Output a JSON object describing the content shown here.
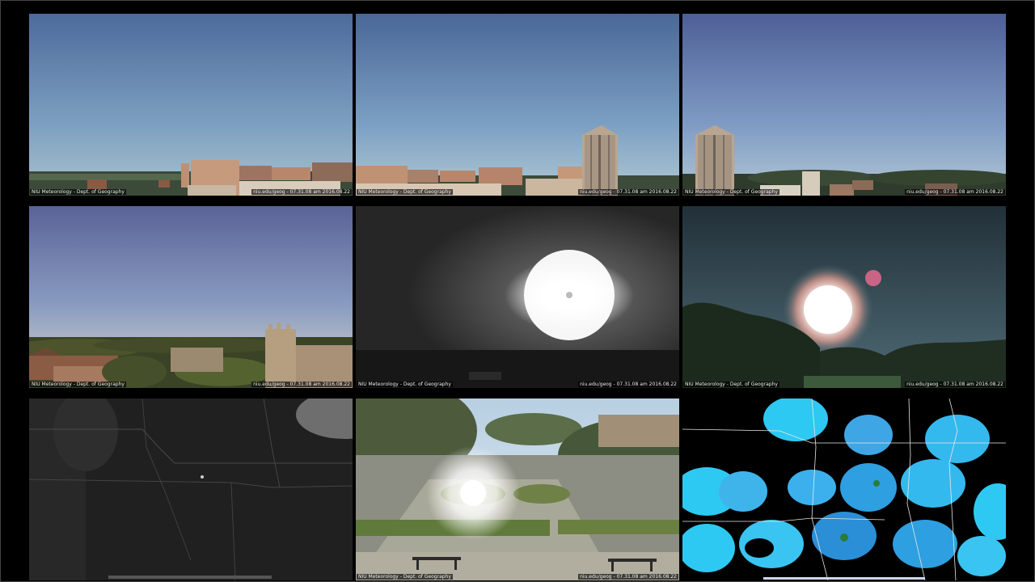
{
  "page": {
    "background_color": "#000000",
    "cameras": [
      {
        "name": "rooftop-east",
        "caption_left": "NIU Meteorology - Dept. of Geography",
        "caption_right": "niu.edu/geog - 07.31.08 am 2016.08.22"
      },
      {
        "name": "rooftop-holmes",
        "caption_left": "NIU Meteorology - Dept. of Geography",
        "caption_right": "niu.edu/geog - 07.31.08 am 2016.08.22"
      },
      {
        "name": "rooftop-northwest",
        "caption_left": "NIU Meteorology - Dept. of Geography",
        "caption_right": "niu.edu/geog - 07.31.08 am 2016.08.22"
      },
      {
        "name": "altgeld-view",
        "caption_left": "NIU Meteorology - Dept. of Geography",
        "caption_right": "niu.edu/geog - 07.31.08 am 2016.08.22"
      },
      {
        "name": "sun-infrared",
        "caption_left": "NIU Meteorology - Dept. of Geography",
        "caption_right": "niu.edu/geog - 07.31.08 am 2016.08.22"
      },
      {
        "name": "sun-color",
        "caption_left": "NIU Meteorology - Dept. of Geography",
        "caption_right": "niu.edu/geog - 07.31.08 am 2016.08.22"
      },
      {
        "name": "satellite-visible",
        "caption_left": "",
        "caption_right": ""
      },
      {
        "name": "martin-luther-king-commons",
        "caption_left": "NIU Meteorology - Dept. of Geography",
        "caption_right": "niu.edu/geog - 07.31.08 am 2016.08.22"
      },
      {
        "name": "radar-mosaic",
        "caption_left": "",
        "caption_right": ""
      }
    ]
  }
}
